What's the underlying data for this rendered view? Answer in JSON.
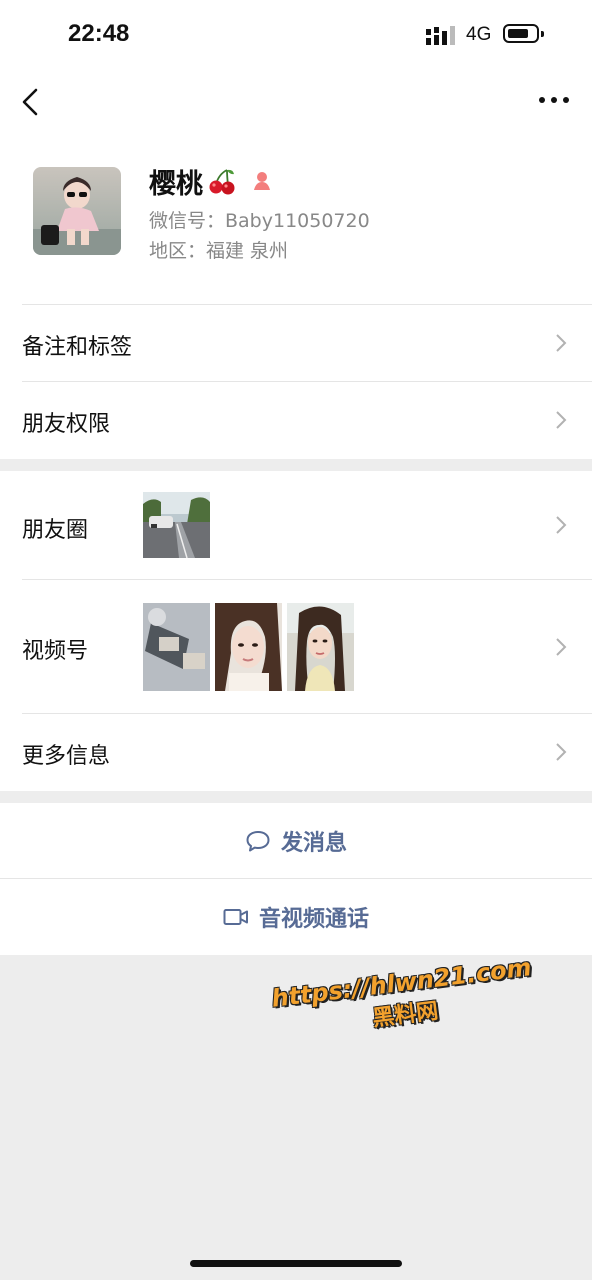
{
  "status_bar": {
    "time": "22:48",
    "network": "4G"
  },
  "profile": {
    "name": "樱桃",
    "wechat_id": "微信号：Baby11050720",
    "region": "地区：福建 泉州"
  },
  "menu": {
    "remarks_tags": "备注和标签",
    "friend_permissions": "朋友权限",
    "moments": "朋友圈",
    "channels": "视频号",
    "more_info": "更多信息"
  },
  "actions": {
    "send_message": "发消息",
    "av_call": "音视频通话"
  },
  "watermark": {
    "url": "https://hlwn21.com",
    "text": "黑料网"
  },
  "colors": {
    "link_blue": "#576b95",
    "background": "#ededed",
    "gender_female": "#f37e7d",
    "watermark": "#f2a12d"
  },
  "icons": [
    "back-arrow-icon",
    "more-dots-icon",
    "cherry-emoji-icon",
    "female-icon",
    "chevron-right-icon",
    "chat-bubble-icon",
    "video-camera-icon"
  ]
}
